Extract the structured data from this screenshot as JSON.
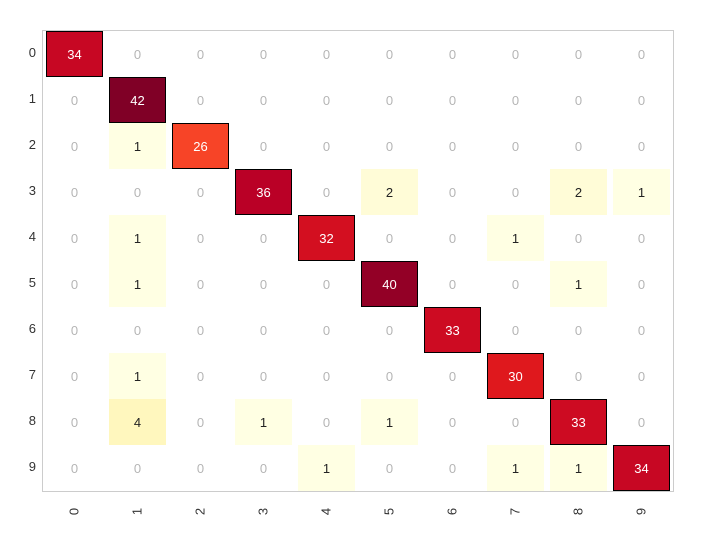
{
  "chart_data": {
    "type": "heatmap",
    "row_labels": [
      "0",
      "1",
      "2",
      "3",
      "4",
      "5",
      "6",
      "7",
      "8",
      "9"
    ],
    "col_labels": [
      "0",
      "1",
      "2",
      "3",
      "4",
      "5",
      "6",
      "7",
      "8",
      "9"
    ],
    "matrix": [
      [
        34,
        0,
        0,
        0,
        0,
        0,
        0,
        0,
        0,
        0
      ],
      [
        0,
        42,
        0,
        0,
        0,
        0,
        0,
        0,
        0,
        0
      ],
      [
        0,
        1,
        26,
        0,
        0,
        0,
        0,
        0,
        0,
        0
      ],
      [
        0,
        0,
        0,
        36,
        0,
        2,
        0,
        0,
        2,
        1
      ],
      [
        0,
        1,
        0,
        0,
        32,
        0,
        0,
        1,
        0,
        0
      ],
      [
        0,
        1,
        0,
        0,
        0,
        40,
        0,
        0,
        1,
        0
      ],
      [
        0,
        0,
        0,
        0,
        0,
        0,
        33,
        0,
        0,
        0
      ],
      [
        0,
        1,
        0,
        0,
        0,
        0,
        0,
        30,
        0,
        0
      ],
      [
        0,
        4,
        0,
        1,
        0,
        1,
        0,
        0,
        33,
        0
      ],
      [
        0,
        0,
        0,
        0,
        1,
        0,
        0,
        1,
        1,
        34
      ]
    ],
    "colorscale": "YlOrRd",
    "vmin": 0,
    "vmax": 42
  }
}
